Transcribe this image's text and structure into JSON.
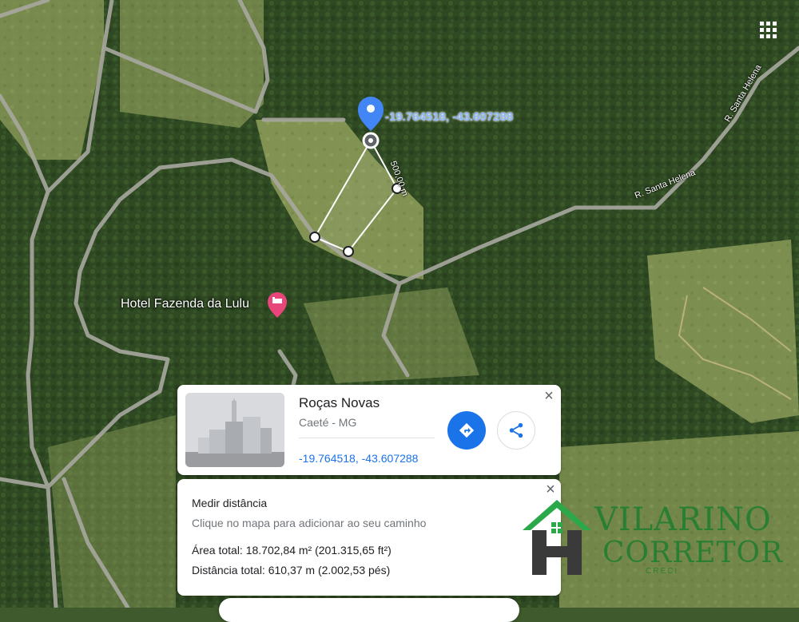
{
  "map": {
    "place_label": "Hotel Fazenda da Lulu",
    "pin_coordinates": "-19.764518, -43.607288",
    "segment_distance": "500,00 m",
    "roads": [
      {
        "name": "R. Santa Helena"
      },
      {
        "name": "R. Santa Helena"
      }
    ]
  },
  "place_card": {
    "name": "Roças Novas",
    "subtitle": "Caeté - MG",
    "coordinates": "-19.764518, -43.607288",
    "close_icon": "close-icon",
    "directions_icon": "directions-icon",
    "share_icon": "share-icon"
  },
  "measure_card": {
    "title": "Medir distância",
    "hint": "Clique no mapa para adicionar ao seu caminho",
    "area": "Área total: 18.702,84 m² (201.315,65 ft²)",
    "distance": "Distância total: 610,37 m (2.002,53 pés)",
    "close_icon": "close-icon"
  },
  "watermark": {
    "line1": "VILARINO",
    "line2": "CORRETOR",
    "line3": "CRECI"
  },
  "colors": {
    "accent": "#1a73e8",
    "pin": "#4285f4",
    "hotel_pin": "#e8457a",
    "watermark": "#1e7d2e"
  }
}
